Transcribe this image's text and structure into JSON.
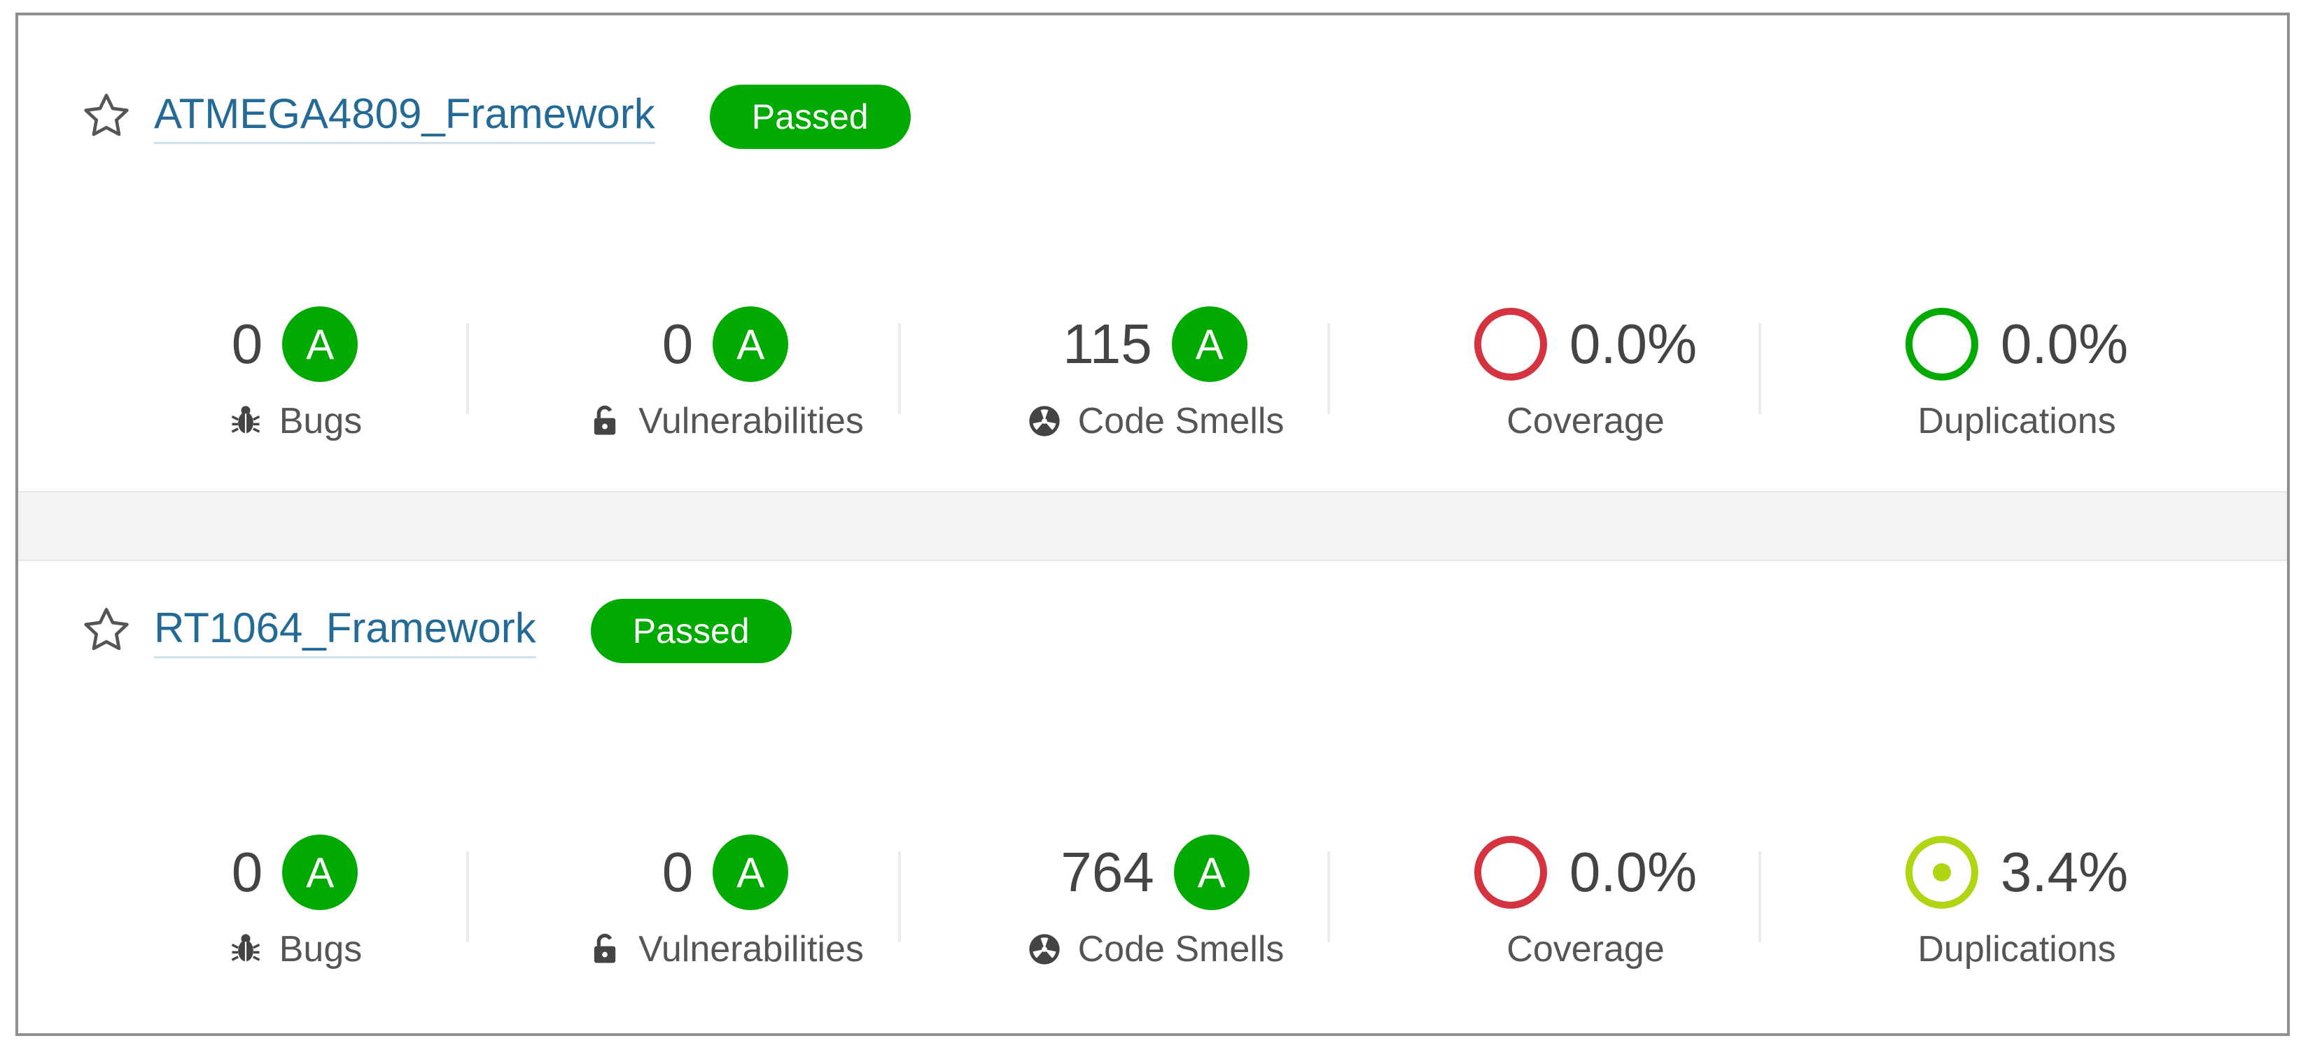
{
  "colors": {
    "link": "#236a97",
    "passed": "#00aa00",
    "rating_a": "#00aa00",
    "coverage_bad": "#d4333f",
    "duplication_good": "#00aa00",
    "duplication_warn": "#b0d513"
  },
  "projects": [
    {
      "name": "ATMEGA4809_Framework",
      "quality_gate": "Passed",
      "bugs": {
        "value": "0",
        "rating": "A",
        "label": "Bugs",
        "icon": "bug-icon"
      },
      "vulnerabilities": {
        "value": "0",
        "rating": "A",
        "label": "Vulnerabilities",
        "icon": "lock-icon"
      },
      "code_smells": {
        "value": "115",
        "rating": "A",
        "label": "Code Smells",
        "icon": "radiation-icon"
      },
      "coverage": {
        "value": "0.0%",
        "label": "Coverage",
        "indicator": "red-circle-icon"
      },
      "duplications": {
        "value": "0.0%",
        "label": "Duplications",
        "indicator": "green-circle-icon"
      }
    },
    {
      "name": "RT1064_Framework",
      "quality_gate": "Passed",
      "bugs": {
        "value": "0",
        "rating": "A",
        "label": "Bugs",
        "icon": "bug-icon"
      },
      "vulnerabilities": {
        "value": "0",
        "rating": "A",
        "label": "Vulnerabilities",
        "icon": "lock-icon"
      },
      "code_smells": {
        "value": "764",
        "rating": "A",
        "label": "Code Smells",
        "icon": "radiation-icon"
      },
      "coverage": {
        "value": "0.0%",
        "label": "Coverage",
        "indicator": "red-circle-icon"
      },
      "duplications": {
        "value": "3.4%",
        "label": "Duplications",
        "indicator": "yellowgreen-dot-circle-icon"
      }
    }
  ]
}
